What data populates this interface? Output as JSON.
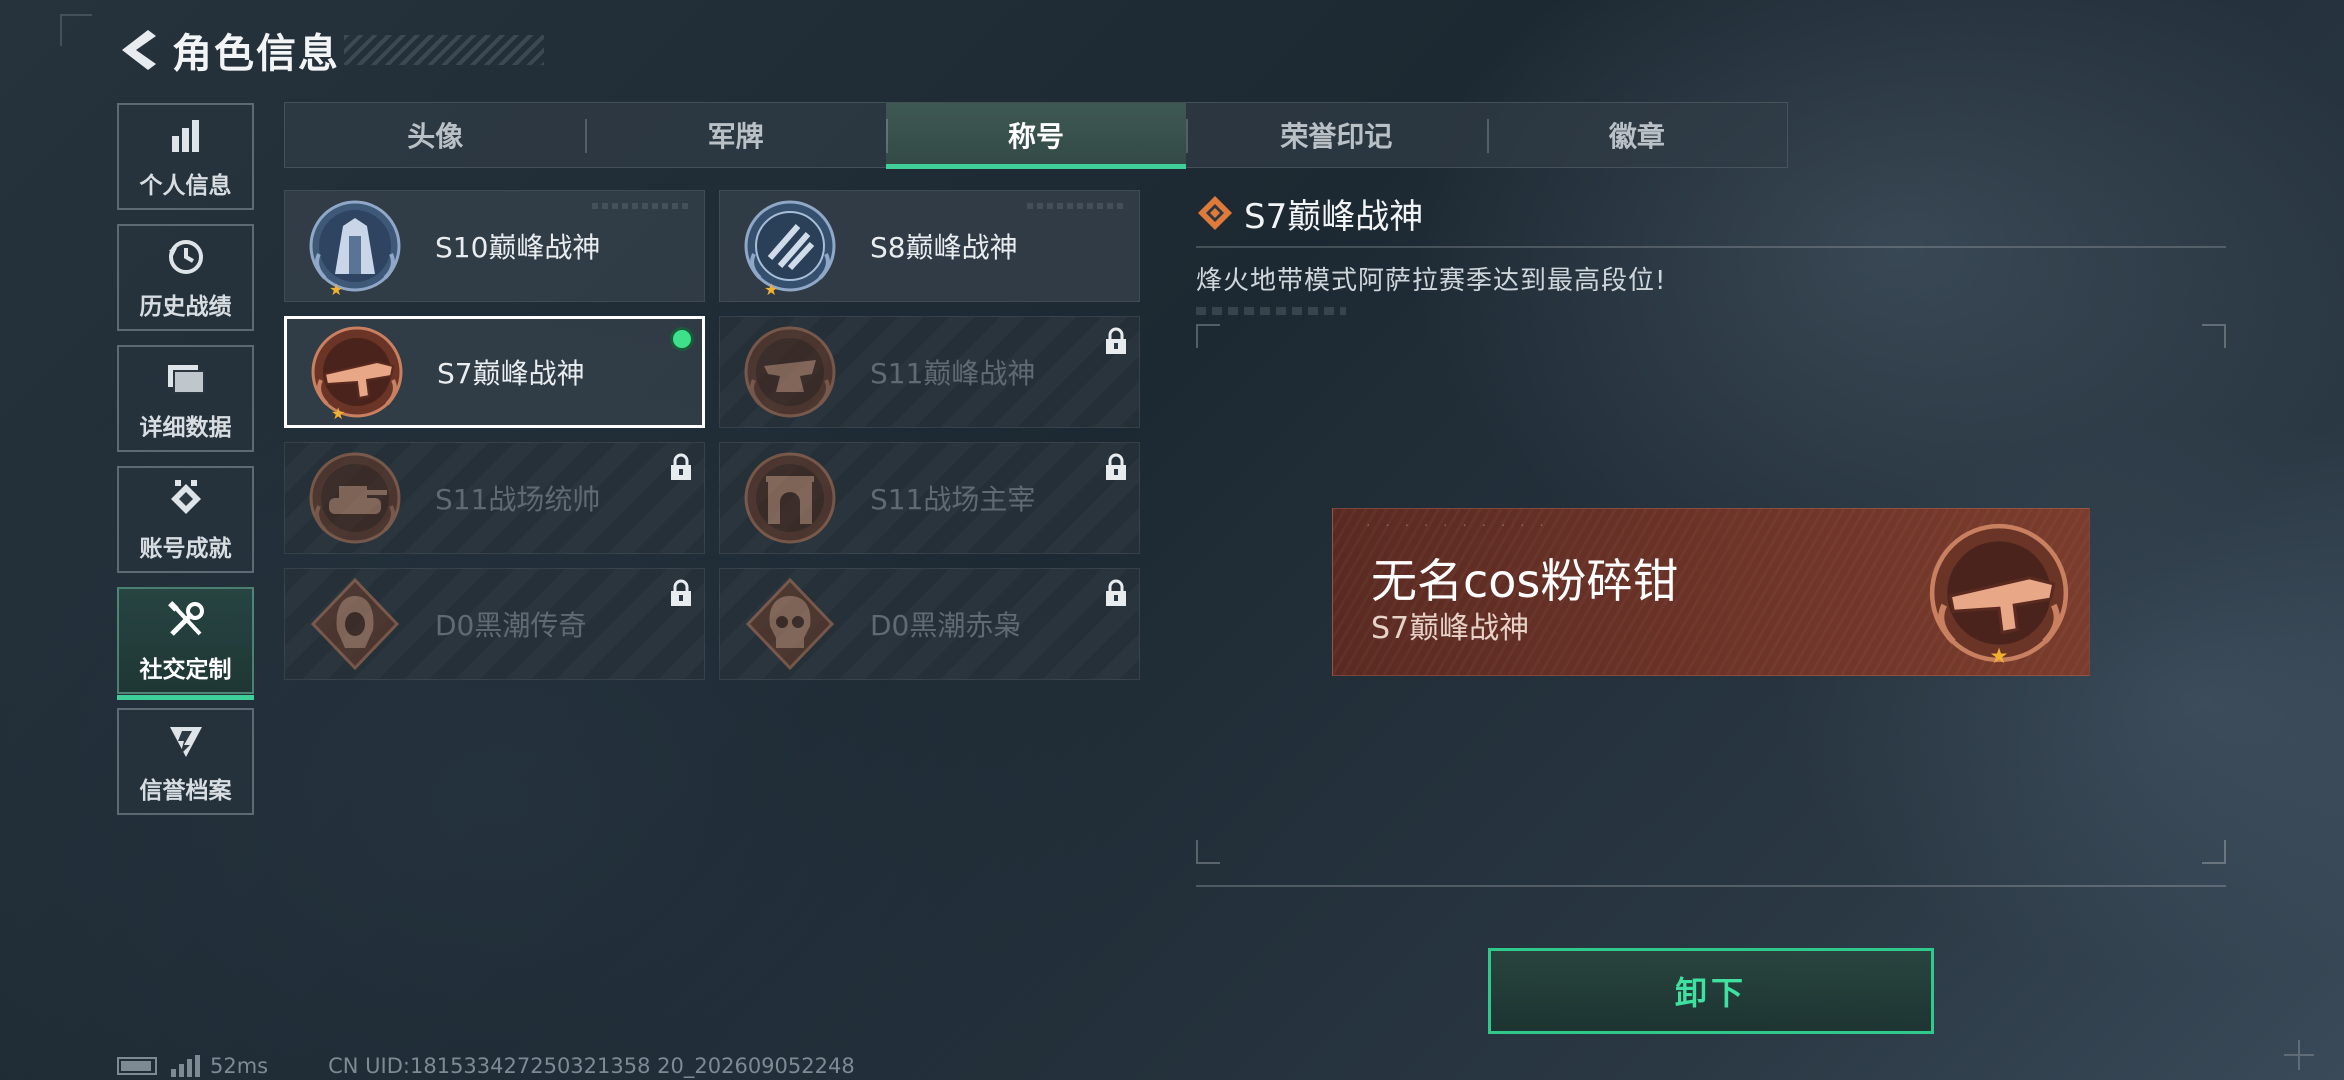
{
  "header": {
    "title": "角色信息"
  },
  "sidebar": {
    "items": [
      {
        "label": "个人信息",
        "icon": "bar-chart-icon",
        "active": false
      },
      {
        "label": "历史战绩",
        "icon": "history-clock-icon",
        "active": false
      },
      {
        "label": "详细数据",
        "icon": "folder-icon",
        "active": false
      },
      {
        "label": "账号成就",
        "icon": "achievement-icon",
        "active": false
      },
      {
        "label": "社交定制",
        "icon": "tools-icon",
        "active": true
      },
      {
        "label": "信誉档案",
        "icon": "credit-shield-icon",
        "active": false
      }
    ]
  },
  "tabs": [
    {
      "label": "头像",
      "active": false
    },
    {
      "label": "军牌",
      "active": false
    },
    {
      "label": "称号",
      "active": true
    },
    {
      "label": "荣誉印记",
      "active": false
    },
    {
      "label": "徽章",
      "active": false
    }
  ],
  "titles": [
    {
      "name": "S10巅峰战神",
      "locked": false,
      "selected": false,
      "equipped": false,
      "badge": "blue-tower-badge-icon"
    },
    {
      "name": "S8巅峰战神",
      "locked": false,
      "selected": false,
      "equipped": false,
      "badge": "blue-emblem-badge-icon"
    },
    {
      "name": "S7巅峰战神",
      "locked": false,
      "selected": true,
      "equipped": true,
      "badge": "bronze-gun-badge-icon"
    },
    {
      "name": "S11巅峰战神",
      "locked": true,
      "selected": false,
      "equipped": false,
      "badge": "bronze-anvil-badge-icon"
    },
    {
      "name": "S11战场统帅",
      "locked": true,
      "selected": false,
      "equipped": false,
      "badge": "bronze-tank-badge-icon"
    },
    {
      "name": "S11战场主宰",
      "locked": true,
      "selected": false,
      "equipped": false,
      "badge": "bronze-arch-badge-icon"
    },
    {
      "name": "D0黑潮传奇",
      "locked": true,
      "selected": false,
      "equipped": false,
      "badge": "bronze-hooded-badge-icon"
    },
    {
      "name": "D0黑潮赤枭",
      "locked": true,
      "selected": false,
      "equipped": false,
      "badge": "bronze-skull-badge-icon"
    }
  ],
  "detail": {
    "title": "S7巅峰战神",
    "description": "烽火地带模式阿萨拉赛季达到最高段位!"
  },
  "nameplate": {
    "player_name": "无名cos粉碎钳",
    "title": "S7巅峰战神"
  },
  "unequip_button": {
    "label": "卸下"
  },
  "status": {
    "ping": "52ms",
    "uid": "CN UID:181533427250321358 20_202609052248"
  },
  "colors": {
    "accent": "#3fd09a",
    "bronze": "#7a3c2c",
    "equipped_dot": "#3fe08a"
  }
}
